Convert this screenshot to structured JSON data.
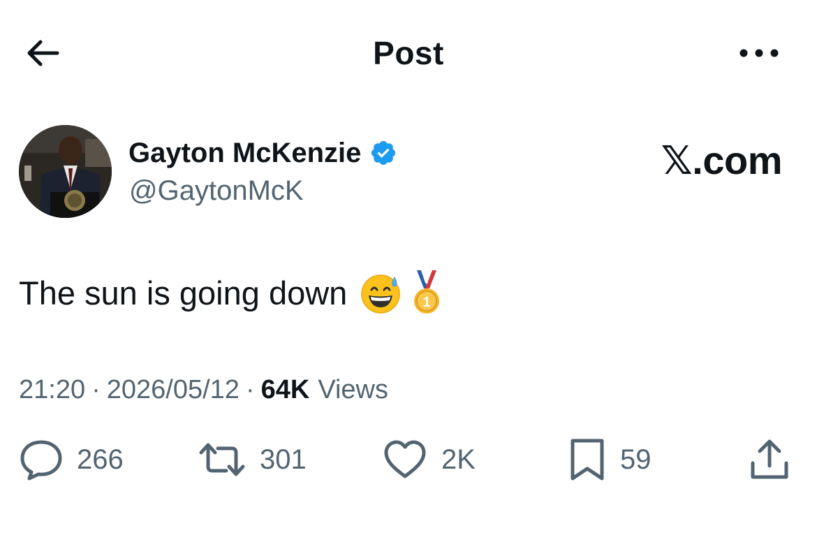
{
  "header": {
    "title": "Post",
    "back_icon": "arrow-left-icon",
    "more_icon": "more-horizontal-icon"
  },
  "author": {
    "name": "Gayton McKenzie",
    "handle": "@GaytonMcK",
    "verified": true,
    "verified_color": "#1d9bf0"
  },
  "watermark": "𝕏.com",
  "post": {
    "text": "The sun is going down",
    "emojis": [
      "grinning-face-with-sweat-emoji",
      "first-place-medal-emoji"
    ]
  },
  "meta": {
    "time": "21:20",
    "separator": "·",
    "date": "2026/05/12",
    "views_count": "64K",
    "views_label": "Views"
  },
  "actions": {
    "replies": "266",
    "reposts": "301",
    "likes": "2K",
    "bookmarks": "59"
  },
  "colors": {
    "text": "#0f1419",
    "secondary": "#536471",
    "background": "#ffffff"
  }
}
